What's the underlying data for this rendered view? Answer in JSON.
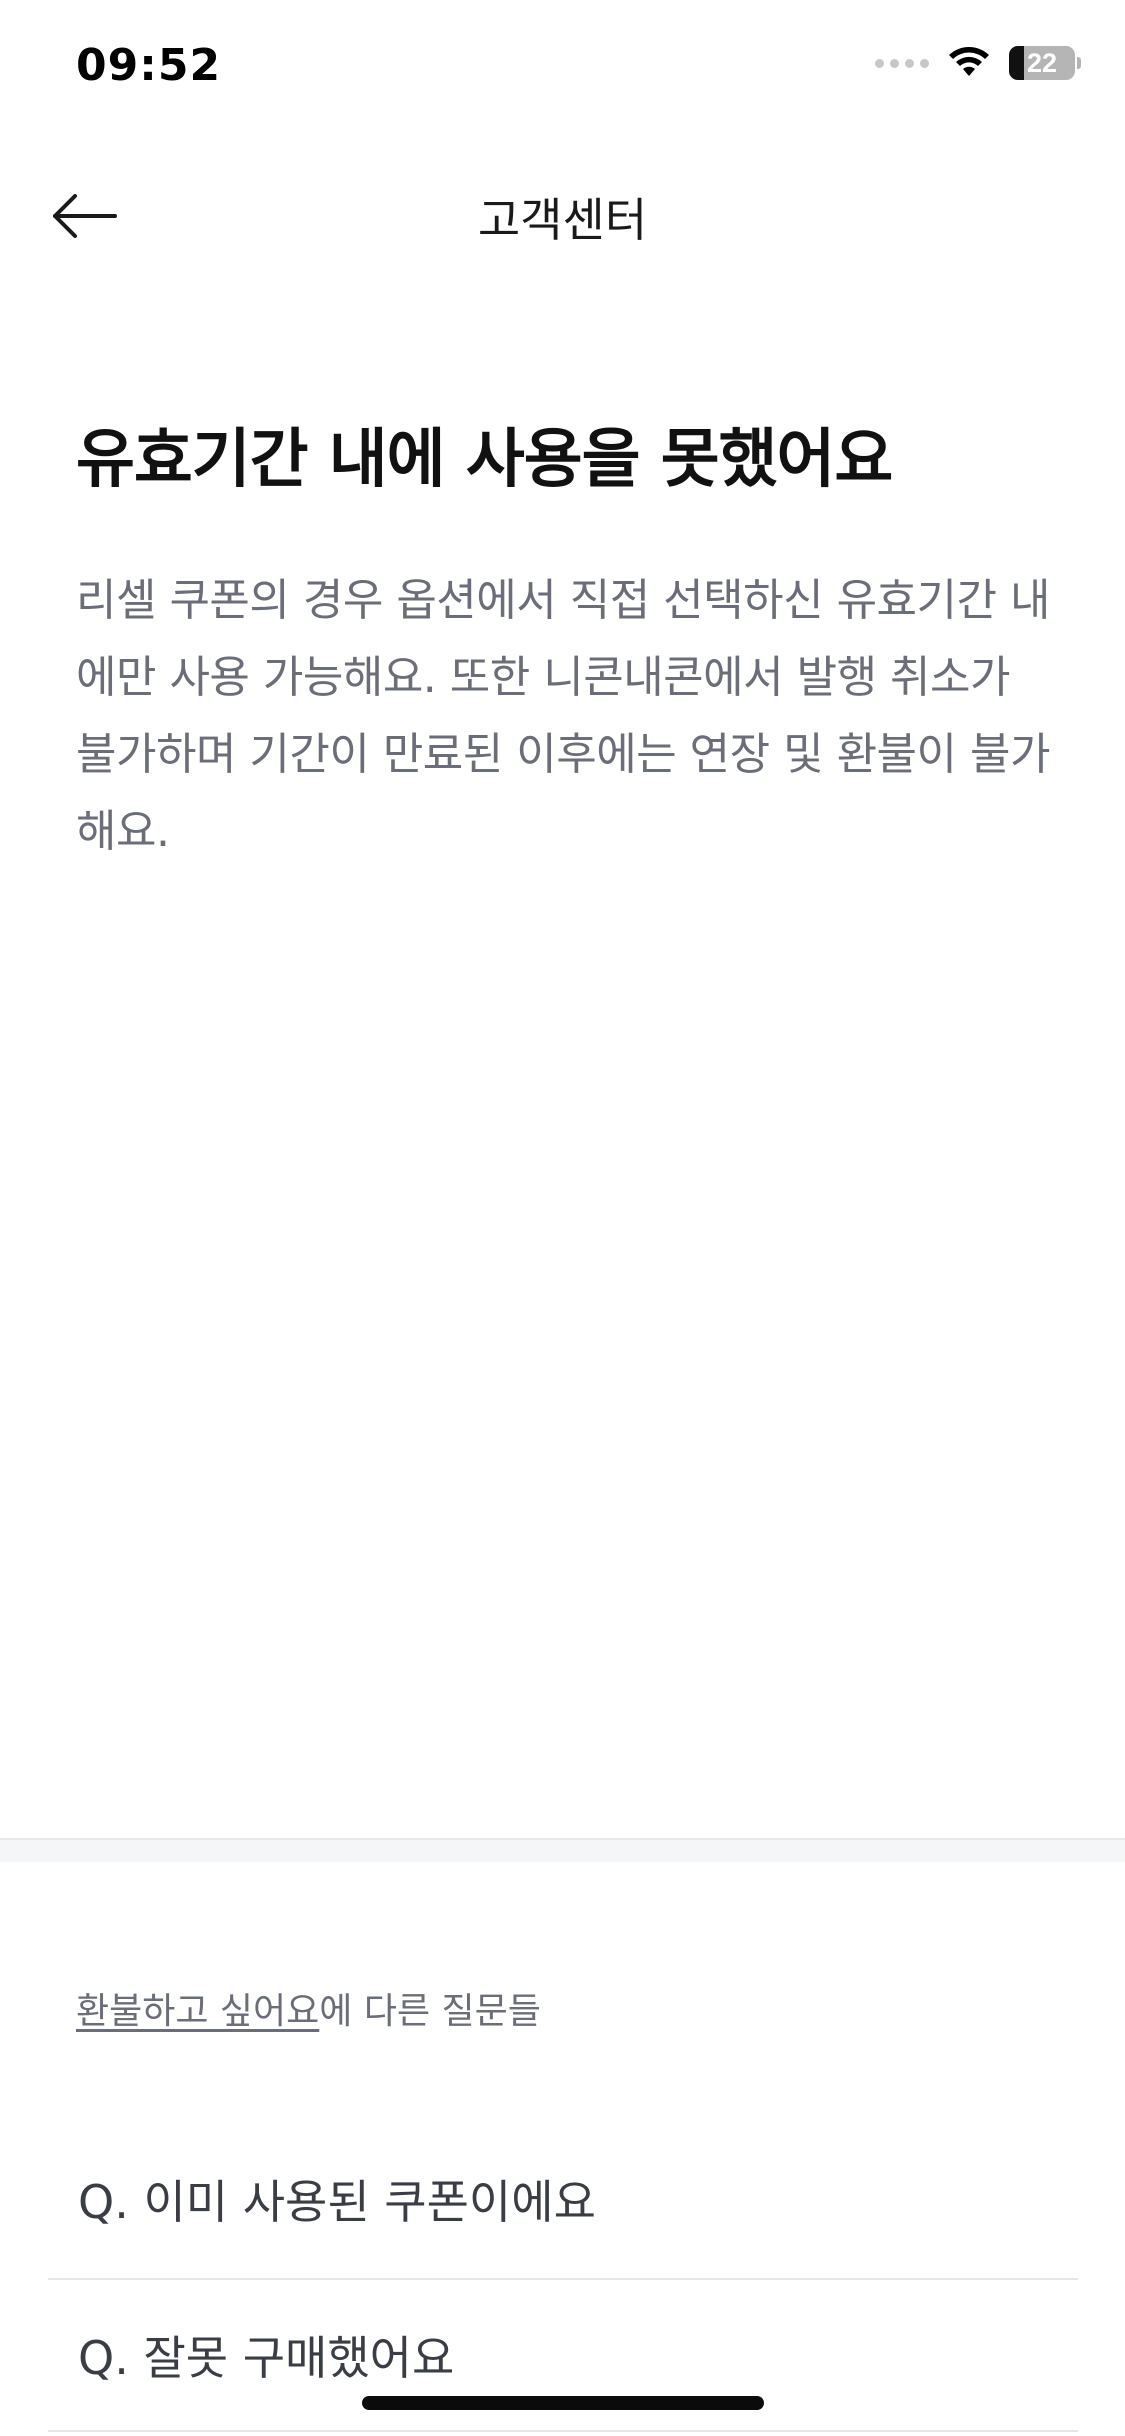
{
  "status_bar": {
    "time": "09:52",
    "battery": "22",
    "battery_fraction": 0.22,
    "icons": [
      "cellular-signal-icon",
      "wifi-icon",
      "battery-icon"
    ]
  },
  "nav": {
    "back_icon": "arrow-left-icon",
    "title": "고객센터"
  },
  "article": {
    "title": "유효기간 내에 사용을 못했어요",
    "body": "리셀 쿠폰의 경우 옵션에서 직접 선택하신 유효기간 내에만 사용 가능해요. 또한 니콘내콘에서 발행 취소가 불가하며 기간이 만료된 이후에는 연장 및 환불이 불가해요."
  },
  "related": {
    "category_link": "환불하고 싶어요",
    "heading_suffix": "에 다른 질문들",
    "questions": [
      "Q. 이미 사용된 쿠폰이에요",
      "Q. 잘못 구매했어요"
    ]
  },
  "colors": {
    "title_text": "#111111",
    "body_text": "#6b6e78",
    "divider": "#f5f6f8"
  }
}
